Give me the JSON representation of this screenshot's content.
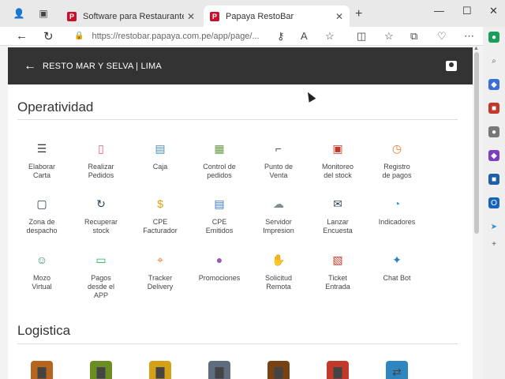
{
  "browser": {
    "tabs": [
      {
        "title": "Software para Restaurante - Pap",
        "favicon": "P"
      },
      {
        "title": "Papaya RestoBar",
        "favicon": "P"
      }
    ],
    "url": "https://restobar.papaya.com.pe/app/page/..."
  },
  "app": {
    "store_name": "RESTO MAR Y SELVA | LIMA"
  },
  "sections": {
    "operatividad": {
      "title": "Operatividad",
      "items": [
        {
          "label": "Elaborar\nCarta",
          "icon": "menu-board-icon",
          "color": "#3b3b3b"
        },
        {
          "label": "Realizar\nPedidos",
          "icon": "tablet-hand-icon",
          "color": "#e05a6a"
        },
        {
          "label": "Caja",
          "icon": "cash-register-icon",
          "color": "#4a90c2"
        },
        {
          "label": "Control de\npedidos",
          "icon": "monitor-list-icon",
          "color": "#6a9c4a"
        },
        {
          "label": "Punto de\nVenta",
          "icon": "barcode-scanner-icon",
          "color": "#555555"
        },
        {
          "label": "Monitoreo\ndel stock",
          "icon": "stock-monitor-icon",
          "color": "#c0392b"
        },
        {
          "label": "Registro\nde pagos",
          "icon": "payment-clock-icon",
          "color": "#e67e22"
        },
        {
          "label": "Zona de\ndespacho",
          "icon": "dispatch-screen-icon",
          "color": "#2c3e50"
        },
        {
          "label": "Recuperar\nstock",
          "icon": "refresh-icon",
          "color": "#2c3e50"
        },
        {
          "label": "CPE\nFacturador",
          "icon": "invoice-icon",
          "color": "#d4a017"
        },
        {
          "label": "CPE\nEmitidos",
          "icon": "tray-docs-icon",
          "color": "#3a7bd5"
        },
        {
          "label": "Servidor\nImpresion",
          "icon": "cloud-server-icon",
          "color": "#7f8c8d"
        },
        {
          "label": "Lanzar\nEncuesta",
          "icon": "survey-icon",
          "color": "#34495e"
        },
        {
          "label": "Indicadores",
          "icon": "indicators-chart-icon",
          "color": "#3498db"
        },
        {
          "label": "Mozo\nVirtual",
          "icon": "robot-waiter-icon",
          "color": "#2d8a6e"
        },
        {
          "label": "Pagos\ndesde el\nAPP",
          "icon": "card-payment-icon",
          "color": "#27ae60"
        },
        {
          "label": "Tracker\nDelivery",
          "icon": "map-tracker-icon",
          "color": "#e67e22"
        },
        {
          "label": "Promociones",
          "icon": "balloons-icon",
          "color": "#9b59b6"
        },
        {
          "label": "Solicitud\nRemota",
          "icon": "remote-request-icon",
          "color": "#e74c3c"
        },
        {
          "label": "Ticket\nEntrada",
          "icon": "ticket-icon",
          "color": "#c0392b"
        },
        {
          "label": "Chat Bot",
          "icon": "chatbot-icon",
          "color": "#2980b9"
        }
      ]
    },
    "logistica": {
      "title": "Logistica"
    }
  }
}
